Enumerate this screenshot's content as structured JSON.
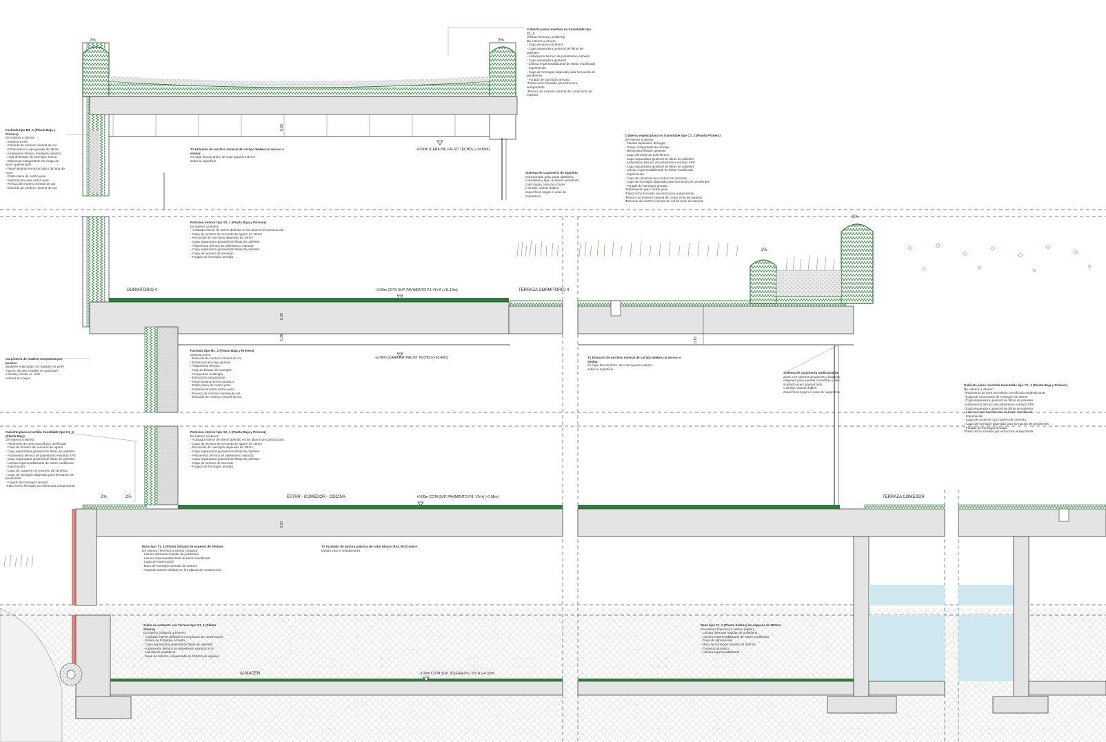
{
  "rooms": {
    "dormitorio": "DORMITORIO 4",
    "terraza_dormitorio": "TERRAZA DORMITORIO 4",
    "estar": "ESTAR - COMEDOR - COCINA",
    "terraza_comedor": "TERRAZA COMEDOR",
    "almacen": "ALMACEN"
  },
  "levels": {
    "ceiling_top": "+6.50m (CARA INF. FALSO TECHO) (+14.80m)",
    "floor_p1": "+3.00m COTA SUP. PAVIMENTO P.1 VIV A (+11.19m)",
    "ceiling_mid": "+2.80m (CARA INF. FALSO TECHO) (+10.40m)",
    "floor_pb": "+0.00m COTA SUP. PAVIMENTO P.B. VIV A (+7.58m)",
    "floor_ps": "-3.20m COTA SUP. SOLERA P.S. VIV A (+4.33m)"
  },
  "dims": {
    "d030": "0.30",
    "d015": "0.15"
  },
  "slopes": {
    "s2": "2%"
  },
  "notes": {
    "cubierta_c1_3": {
      "title": "Cubierta plana invertida no transitable tipo C1_3",
      "lines": [
        "(Planta Primera y Cubierta)",
        "De exterior a interior:",
        "- Capa de grava de 50mm.",
        "- Capa separadora geotextil de fibras de poliéster",
        "- Aislamiento térmico de poliestireno extruido",
        "- Capa separadora geotextil",
        "- Lámina impermeabilizante de betún modificado",
        "- Imprimación.",
        "- Capa de hormigón aligerado para formación de pendientes",
        "- Forjado de hormigón armado.",
        "*Falso techo formado por estructura autoportante",
        "*Revoco de mortero mineral de cal de 2mm de espesor"
      ]
    },
    "fachada_m1_1": {
      "title": "Fachada tipo M1_1 (Planta Baja y Primera)",
      "lines": [
        "De exterior a interior:",
        "- Sistema SATE:",
        "- Enlucido de mortero mineral de cal",
        "- Enfoscado en capa gruesa de 15mm",
        "- Aislamiento térmico mediante plancha",
        "- Hoja de bloque de hormigón hueco",
        "- Estructura autoportante de chapa de acero galvanizado",
        "- Panel aislante termo-acústico de lana de roca",
        "- Doble placa de cartón-yeso",
        "- Imprimación para cartón-yeso",
        "- Revoco de mortero mineral de cal",
        "- Enlucido de mortero mineral de cal"
      ]
    },
    "t1_top": {
      "title": "T1 Enlucido de mortero mineral de cal tipo Weber.cal revoco o similar,",
      "lines": [
        "en capa fina de 2mm, de color igual al exterior",
        "sobre la superficie"
      ]
    },
    "carpinteria": {
      "title": "Sistema de carpintería de aluminio",
      "lines": [
        "extrusionado para guías abatibles,",
        "correderas y fijas, acabado anodizado",
        "color según carta de colores",
        "o similar. Vidrios dobles",
        "específicos según el caso de",
        "carpintería."
      ]
    },
    "cubierta_c1_2": {
      "title": "Cubierta vegetal plana no transitable tipo C1_2 (Planta Primera)",
      "lines": [
        "De exterior a interior:",
        "- Plantas tapizantes del lugar",
        "- Grava compactada de drenaje",
        "- Membrana filtrante geotextil",
        "- Capa drenante de poliestireno",
        "- Capa separadora geotextil de fibras de poliéster",
        "- Aislamiento térmico de poliestireno extruido XPS",
        "- Capa separadora geotextil de fibras de poliéster",
        "- Lámina impermeabilizante de betún modificado",
        "- Imprimación",
        "- Capa de cosarres con mortero de cemento",
        "- Capa de hormigón aligerado para formación de pendientes",
        "- Forjado de hormigón armado",
        "*Imprimación para cartón-yeso",
        "*Falso techo formado por estructura autoportante",
        "*Revoco de mortero mineral de cal de 2mm de espesor",
        "*Enlucido de mortero mineral de cal de 2mm de espesor"
      ]
    },
    "particion_p1": {
      "title": "Partición interior tipo S2_1 (Planta Baja y Primera)",
      "lines": [
        "De interior a interior:",
        "- Acabado interior de 15mm definido en los planos de construcción",
        "- Capa de mortero de cemento de agarre de 10mm",
        "- Recrecido de hormigón aligerado de 20mm",
        "- Capa separadora geotextil de fibras de poliéster",
        "- Aislamiento térmico de poliestireno extruido",
        "- Capa separadora geotextil de fibras de poliéster",
        "- Capa de mortero de cemento",
        "- Forjado de hormigón armado"
      ]
    },
    "t1_mid": {
      "title": "T1 Enlucido de mortero mineral de cal tipo Weber.cal revoco o similar,",
      "lines": [
        "en capa fina de 2mm, de color igual al exterior",
        "sobre la superficie"
      ]
    },
    "fachada_m1_2": {
      "title": "Fachada tipo M1_2 (Planta Baja y Primera)",
      "lines": [
        "Sistema SATE",
        "- Enlucido de mortero mineral de cal",
        "- Enfoscado en capa gruesa",
        "- Aislamiento térmico",
        "- Hoja de bloque de hormigón",
        "- Compuesto multicapa",
        "- Estructura autoportante",
        "- Panel aislante termo-acústico",
        "- Doble placa de cartón-yeso",
        "- Imprimación para cartón-yeso",
        "- Revoco de mortero mineral de cal",
        "- Enlucido de mortero mineral de cal"
      ]
    },
    "carpinteria_madera": {
      "title": "Carpintería de madera compuesta por puertas",
      "lines": [
        "abatibles realizadas con bastidor de perfil",
        "macizo, de pino tratable en autoclave",
        "o similar, lacado en color",
        "exterior en chapa"
      ]
    },
    "carpinteria_acero": {
      "title": "Sistema de carpintería tradicional de",
      "lines": [
        "acero con sistema de goznes y bisagras",
        "integrado para puertas corredizas y fijas,",
        "acabado acero galvanizado",
        "o similar. Vidrios dobles",
        "específicos según el caso de carpintería."
      ]
    },
    "cubierta_c1_1": {
      "title": "Cubierta plana invertida transitable tipo C1_1 (Planta Baja y Primera)",
      "lines": [
        "De exterior a interior:",
        "- Pavimento de gres porcelánico rectificado antideslizante",
        "- Capa de compresión de hormigón de 30mm",
        "- Capa separadora geotextil de fibras de poliéster",
        "- Aislamiento térmico de poliestireno extruido XPS",
        "- Capa separadora geotextil de fibras de poliéster",
        "- Lámina impermeabilizante de betún modificado",
        "- Imprimación",
        "- Capa de cosarres con mortero de cemento",
        "- Capa de hormigón aligerado para formación de pendientes",
        "- Forjado de hormigón armado",
        "*Falso techo formado por estructura autoportante"
      ]
    },
    "cubierta_c1_4": {
      "title": "Cubierta plana invertida transitable tipo C1_4 (Planta Baja)",
      "lines": [
        "De exterior a interior:",
        "- Pavimento de gres porcelánico rectificado",
        "- Capa de mortero de cemento de agarre",
        "- Capa separadora geotextil de fibras de poliéster",
        "- Aislamiento térmico de poliestireno extruido XPS",
        "- Capa separadora geotextil de fibras de poliéster",
        "- Lámina impermeabilizante de betún modificado",
        "- Imprimación",
        "- Capa de cosarres con mortero de cemento",
        "- Capa de hormigón aligerado para formación de pendientes",
        "- Forjado de hormigón armado",
        "*Falso techo formado por estructura autoportante"
      ]
    },
    "particion_pb": {
      "title": "Partición interior tipo S2_1 (Planta Baja y Primera)",
      "lines": [
        "De interior a interior:",
        "- Acabado interior de 20mm definido en los planos de construcción",
        "- Capa de mortero de cemento de agarre de 10mm",
        "- Recrecido de hormigón aligerado de 20mm",
        "- Capa separadora geotextil de fibras de poliéster",
        "- Aislamiento térmico de poliestireno extruido",
        "- Capa separadora geotextil de fibras de poliéster",
        "- Capa de mortero de cemento",
        "- Forjado de hormigón armado"
      ]
    },
    "muro_t1_1": {
      "title": "Muro tipo T1_1 (Planta Sótano) de espesor de 300mm",
      "lines": [
        "De exterior (Terreno) a interior (Sótano):",
        "- Lámina drenante nodular de polietileno",
        "- Lámina impermeabilizante de betún modificado",
        "- Capa de imprimación",
        "- Muro de hormigón armado de 300mm",
        "- Acabado interior definido en los planos de construcción"
      ]
    },
    "t2": {
      "title": "T2 Acabado de pintura plástica de color blanco RAL 9010 sobre",
      "lines": [
        "forjado visto e instalaciones"
      ]
    },
    "suelo_s1_1": {
      "title": "Suelo en contacto con Terreno tipo S1_1 (Planta Sótano)",
      "lines": [
        "De interior (Sótano) a Terreno:",
        "- Acabado interior definido en los planos de construcción",
        "- Solera de hormigón armado",
        "- Capa separadora geotextil de fibras de poliéster",
        "- Aislamiento térmico de poliestireno extruido XPS",
        "- Lámina de polietileno",
        "- Base de zahorra compactada de 150mm de espesor"
      ]
    },
    "muro_t1_2": {
      "title": "Muro tipo T1_2 (Planta Sótano) de espesor de 300mm",
      "lines": [
        "De exterior (Terreno) a interior (Aljibe):",
        "- Lámina drenante nodular de polietileno",
        "- Lámina impermeabilizante de betún modificado",
        "- Capa de imprimación",
        "- Muro de hormigón armado de 300mm",
        "- Cemento osmótico",
        "- Lámina impermeabilizante"
      ]
    }
  },
  "colors": {
    "insulation_green": "#2e7d3c",
    "concrete": "#e4e4e4",
    "water": "#cfe7ee",
    "plants": "#8fb08a",
    "membrane_red": "#c0392b"
  }
}
